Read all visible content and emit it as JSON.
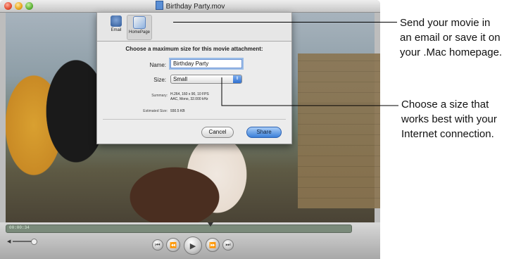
{
  "window": {
    "title": "Birthday Party.mov"
  },
  "toolbar": {
    "email_label": "Email",
    "homepage_label": "HomePage"
  },
  "sheet": {
    "heading": "Choose a maximum size for this movie attachment:",
    "name_label": "Name:",
    "name_value": "Birthday Party",
    "size_label": "Size:",
    "size_value": "Small",
    "summary_label": "Summary:",
    "summary_line1": "H.264, 160 x 90, 10 FPS",
    "summary_line2": "AAC, Mono, 32.000 kHz",
    "estimated_label": "Estimated Size:",
    "estimated_value": "930.5 KB",
    "cancel_label": "Cancel",
    "share_label": "Share"
  },
  "player": {
    "timecode": "00:00:34"
  },
  "callouts": {
    "send_line1": "Send your movie in",
    "send_line2": "an email or save it on",
    "send_line3": "your .Mac homepage.",
    "size_line1": "Choose a size that",
    "size_line2": "works best with your",
    "size_line3": "Internet connection."
  }
}
